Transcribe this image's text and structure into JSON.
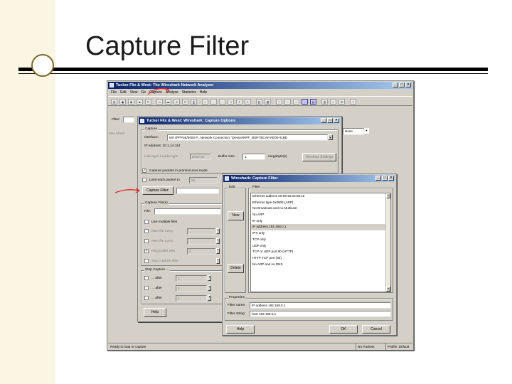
{
  "slide": {
    "title": "Capture Filter"
  },
  "main_window": {
    "title": "Tucker Flix & West: The Wireshark Network Analyzer",
    "menu": [
      "File",
      "Edit",
      "View",
      "Go",
      "Capture",
      "Analyze",
      "Statistics",
      "Help"
    ],
    "filter_label": "Filter:",
    "side_label": "Mac sheet",
    "status_left": "Ready to load or capture",
    "status_mid": "No Packets",
    "status_right": "Profile: Default"
  },
  "options_window": {
    "title": "Tucker Flix & West: Wireshark: Capture Options",
    "capture_group": "Capture",
    "interface_label": "Interface:",
    "interface_value": "Local  \\Device\\NPF_{E9F7BCAF-FE05-41BD",
    "interface_prefix": "MS (PPPoE/3000 P...Network Connection: \\Device\\NPF_{E9F7BCAF-FE05-41BD",
    "ip_label": "IP address: 10.1.14.114",
    "link_layer_label": "Link-layer header type:",
    "link_layer_value": "Ethernet",
    "buffer_label": "Buffer size:",
    "buffer_value": "1",
    "buffer_unit": "megabyte(s)",
    "wireless_button": "Wireless Settings",
    "promiscuous_label": "Capture packets in promiscuous mode",
    "limit_label": "Limit each packet to",
    "limit_value": "65",
    "capture_filter_button": "Capture Filter:",
    "capture_files_group": "Capture File(s)",
    "file_label": "File:",
    "multiple_files_label": "Use multiple files",
    "next_file_every_1": "Next file every",
    "next_file_every_2": "Next file every",
    "ring_buffer_label": "Ring buffer with",
    "ring_buffer_value": "2",
    "stop_after_label": "Stop capture after",
    "stop_group": "Stop Capture ...",
    "after_1": "... after",
    "after_2": "... after",
    "after_3": "... after",
    "after_value": "1",
    "help_button": "Help",
    "name_resolution_value": "None"
  },
  "filter_window": {
    "title": "Wireshark: Capture Filter",
    "edit_group": "Edit",
    "filter_group": "Filter",
    "new_button": "New",
    "delete_button": "Delete",
    "filters": [
      "Ethernet address 00:08:15:00:08:15",
      "Ethernet type 0x0806 (ARP)",
      "No Broadcast and no Multicast",
      "No ARP",
      "IP only",
      "IP address 192.168.0.1",
      "IPX only",
      "TCP only",
      "UDP only",
      "TCP or UDP port 80 (HTTP)",
      "HTTP TCP port (80)",
      "No ARP and no DNS"
    ],
    "selected_index": 5,
    "properties_group": "Properties",
    "filter_name_label": "Filter name:",
    "filter_name_value": "IP address 192.168.0.1",
    "filter_string_label": "Filter string:",
    "filter_string_value": "host 192.168.0.1",
    "help_button": "Help",
    "ok_button": "OK",
    "cancel_button": "Cancel"
  },
  "colors": {
    "titlebar": "#0a246a",
    "window_bg": "#d4d0c8",
    "arrow": "#e02020"
  }
}
